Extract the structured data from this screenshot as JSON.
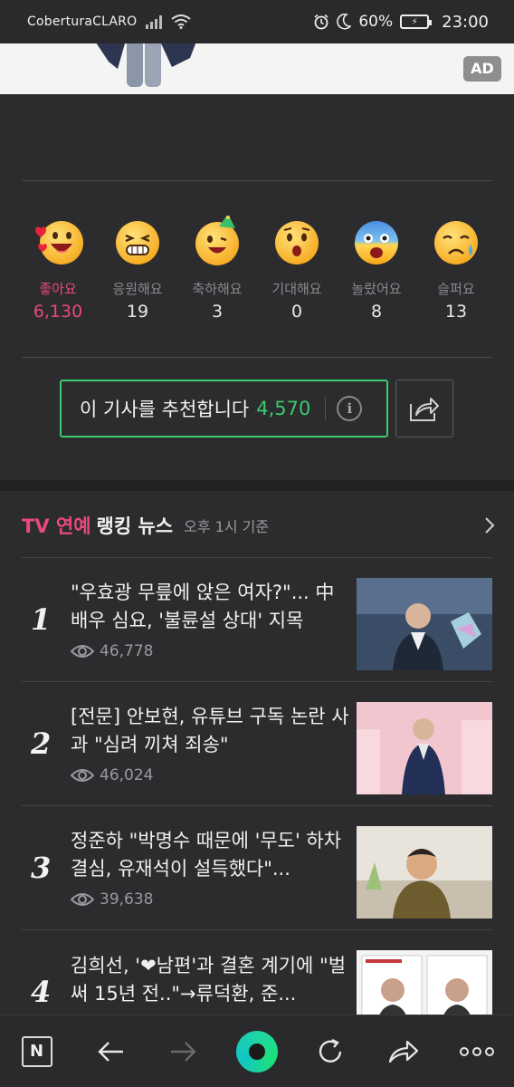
{
  "status_bar": {
    "carrier": "CoberturaCLARO",
    "battery_percent": "60%",
    "time": "23:00"
  },
  "ad": {
    "badge": "AD"
  },
  "reactions": [
    {
      "label": "좋아요",
      "count": "6,130",
      "icon": "love-face-icon",
      "active": true
    },
    {
      "label": "응원해요",
      "count": "19",
      "icon": "cheer-face-icon",
      "active": false
    },
    {
      "label": "축하해요",
      "count": "3",
      "icon": "party-face-icon",
      "active": false
    },
    {
      "label": "기대해요",
      "count": "0",
      "icon": "surprised-face-icon",
      "active": false
    },
    {
      "label": "놀랐어요",
      "count": "8",
      "icon": "shocked-face-icon",
      "active": false
    },
    {
      "label": "슬퍼요",
      "count": "13",
      "icon": "sad-face-icon",
      "active": false
    }
  ],
  "recommend": {
    "label": "이 기사를 추천합니다",
    "count": "4,570"
  },
  "ranking": {
    "tv_label": "TV 연예",
    "title": "랭킹 뉴스",
    "subtitle": "오후 1시 기준",
    "items": [
      {
        "rank": "1",
        "title": "\"우효광 무릎에 앉은 여자?\"... 中 배우 심요, '불륜설 상대' 지목",
        "views": "46,778"
      },
      {
        "rank": "2",
        "title": "[전문] 안보현, 유튜브 구독 논란 사과 \"심려 끼쳐 죄송\"",
        "views": "46,024"
      },
      {
        "rank": "3",
        "title": "정준하 \"박명수 때문에 '무도' 하차 결심, 유재석이 설득했다\"...",
        "views": "39,638"
      },
      {
        "rank": "4",
        "title": "김희선, '❤남편'과 결혼 계기에 \"벌써 15년 전..\"→류덕환, 준...",
        "views": ""
      }
    ]
  },
  "colors": {
    "accent_pink": "#e8497c",
    "accent_green": "#3ac96e"
  }
}
